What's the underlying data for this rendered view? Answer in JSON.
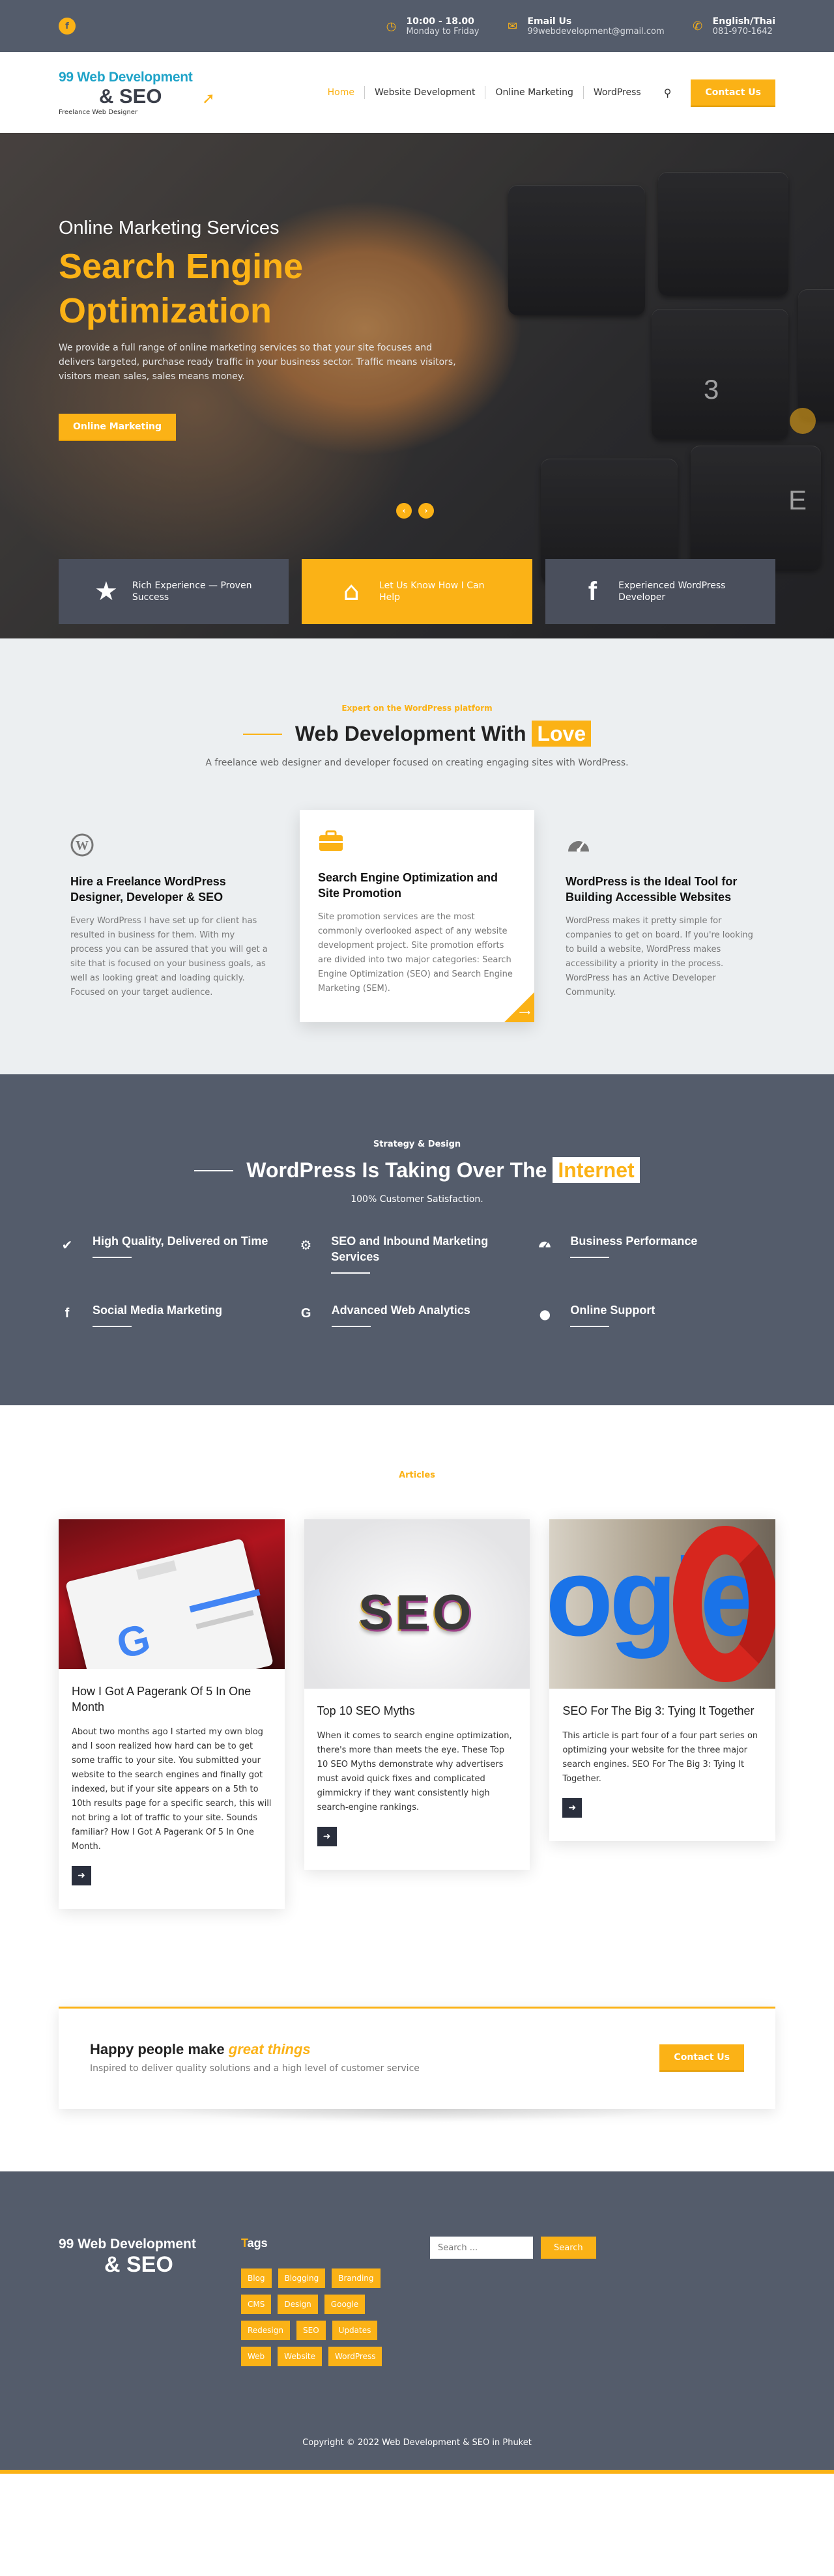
{
  "colors": {
    "accent": "#fbb216",
    "slate": "#545c6b",
    "dark": "#2a2f3d"
  },
  "topbar": {
    "social_icon": "facebook-icon",
    "hours": {
      "title": "10:00 - 18.00",
      "sub": "Monday to Friday",
      "icon": "clock-icon"
    },
    "email": {
      "title": "Email Us",
      "sub": "99webdevelopment@gmail.com",
      "icon": "envelope-icon"
    },
    "lang": {
      "title": "English/Thai",
      "sub": "081-970-1642",
      "icon": "phone-icon"
    }
  },
  "header": {
    "logo": {
      "line1": "99 Web Development",
      "line2": "& SEO",
      "tagline": "Freelance Web Designer"
    },
    "nav": [
      "Home",
      "Website Development",
      "Online Marketing",
      "WordPress"
    ],
    "active_nav": "Home",
    "contact_label": "Contact Us"
  },
  "hero": {
    "kicker": "Online Marketing Services",
    "title": "Search Engine Optimization",
    "text": "We provide a full range of online marketing services so that your site focuses and delivers targeted, purchase ready traffic in your business sector. Traffic means visitors, visitors mean sales, sales means money.",
    "button": "Online Marketing",
    "keys": [
      "3",
      "E"
    ],
    "features": [
      {
        "icon": "star-icon",
        "label": "Rich Experience — Proven Success"
      },
      {
        "icon": "home-icon",
        "label": "Let Us Know How I Can Help"
      },
      {
        "icon": "facebook-icon",
        "label": "Experienced WordPress Developer"
      }
    ]
  },
  "webdev": {
    "kicker": "Expert on the WordPress platform",
    "title": "Web Development With",
    "badge": "Love",
    "sub": "A freelance web designer and developer focused on creating engaging sites with WordPress.",
    "cards": [
      {
        "icon": "wordpress-icon",
        "title": "Hire a Freelance WordPress Designer, Developer & SEO",
        "text": "Every WordPress I have set up for client has resulted in business for them. With my process you can be assured that you will get a site that is focused on your business goals, as well as looking great and loading quickly. Focused on your target audience."
      },
      {
        "icon": "briefcase-icon",
        "title": "Search Engine Optimization and Site Promotion",
        "text": "Site promotion services are the most commonly overlooked aspect of any website development project. Site promotion efforts are divided into two major categories: Search Engine Optimization (SEO) and Search Engine Marketing (SEM)."
      },
      {
        "icon": "dashboard-icon",
        "title": "WordPress is the Ideal Tool for Building Accessible Websites",
        "text": "WordPress makes it pretty simple for companies to get on board. If you're looking to build a website, WordPress makes accessibility a priority in the process. WordPress has an Active Developer Community."
      }
    ]
  },
  "wp": {
    "kicker": "Strategy & Design",
    "title": "WordPress Is Taking Over The",
    "badge": "Internet",
    "sub": "100% Customer Satisfaction.",
    "items": [
      {
        "icon": "check-icon",
        "label": "High Quality, Delivered on Time"
      },
      {
        "icon": "gear-icon",
        "label": "SEO and Inbound Marketing Services"
      },
      {
        "icon": "dashboard-icon",
        "label": "Business Performance"
      },
      {
        "icon": "facebook-icon",
        "label": "Social Media Marketing"
      },
      {
        "icon": "google-icon",
        "label": "Advanced Web Analytics"
      },
      {
        "icon": "user-icon",
        "label": "Online Support"
      }
    ]
  },
  "articles": {
    "kicker": "Articles",
    "posts": [
      {
        "title": "How I Got A Pagerank Of 5 In One Month",
        "text": "About two months ago I started my own blog and I soon realized how hard can be to get some traffic to your site. You submitted your website to the search engines and finally got indexed, but if your site appears on a 5th to 10th results page for a specific search, this will not bring a lot of traffic to your site. Sounds familiar? How I Got A Pagerank Of 5 In One Month."
      },
      {
        "title": "Top 10 SEO Myths",
        "text": "When it comes to search engine optimization, there's more than meets the eye. These Top 10 SEO Myths demonstrate why advertisers must avoid quick fixes and complicated gimmickry if they want consistently high search-engine rankings.",
        "image_text": "SEO"
      },
      {
        "title": "SEO For The Big 3: Tying It Together",
        "text": "This article is part four of a four part series on optimizing your website for the three major search engines. SEO For The Big 3: Tying It Together.",
        "image_text": "ogle"
      }
    ]
  },
  "happy": {
    "title": "Happy people make",
    "title_em": "great things",
    "sub": "Inspired to deliver quality solutions and a high level of customer service",
    "button": "Contact Us"
  },
  "footer": {
    "logo": {
      "line1": "99 Web Development",
      "line2": "& SEO"
    },
    "tags_title_first": "T",
    "tags_title_rest": "ags",
    "tags": [
      "Blog",
      "Blogging",
      "Branding",
      "CMS",
      "Design",
      "Google",
      "Redesign",
      "SEO",
      "Updates",
      "Web",
      "Website",
      "WordPress"
    ],
    "search_placeholder": "Search ...",
    "search_button": "Search",
    "copyright": "Copyright © 2022 Web Development & SEO in Phuket"
  }
}
